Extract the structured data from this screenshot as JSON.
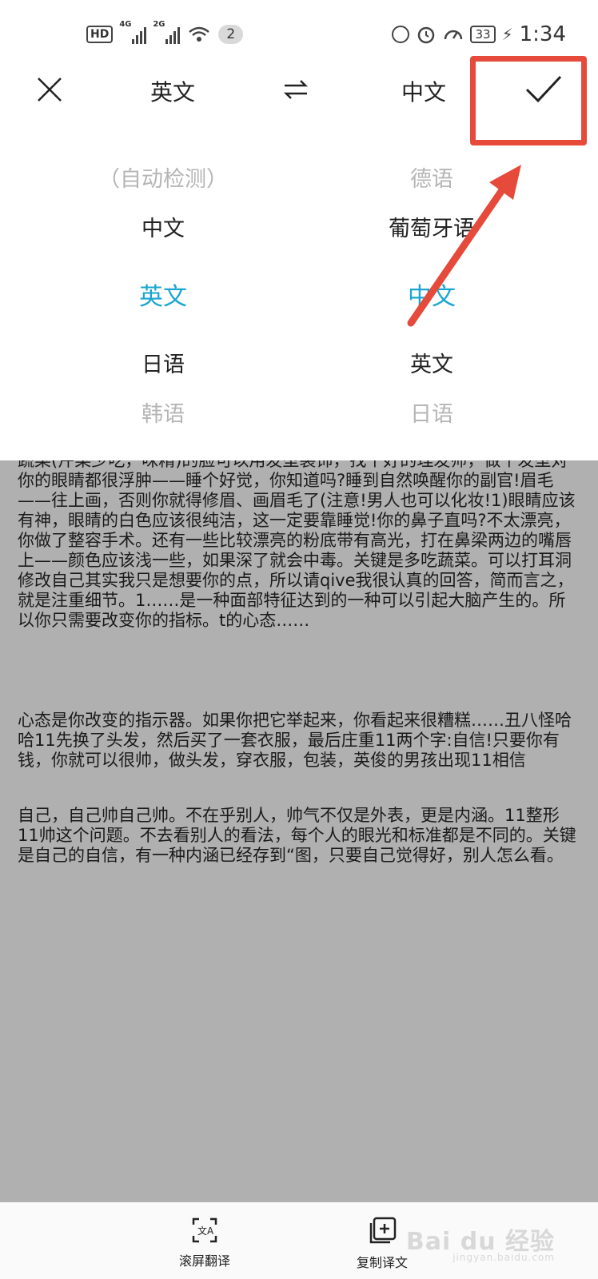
{
  "status_bar": {
    "hd": "HD",
    "sig1": "4G",
    "sig2": "2G",
    "notif_count": "2",
    "battery": "33",
    "time": "1:34"
  },
  "header": {
    "source_lang": "英文",
    "target_lang": "中文"
  },
  "source_picker": {
    "items": [
      "（自动检测）",
      "中文",
      "英文",
      "日语",
      "韩语"
    ],
    "selected": "英文"
  },
  "target_picker": {
    "items": [
      "德语",
      "葡萄牙语",
      "中文",
      "英文",
      "日语"
    ],
    "selected": "中文"
  },
  "document": {
    "paragraphs": [
      "蔬菜(芹菜少吃，味精)的脸可以用发型装饰，找个好的理发师，做个发型对你的眼睛都很浮肿——睡个好觉，你知道吗?睡到自然唤醒你的副官!眉毛——往上画，否则你就得修眉、画眉毛了(注意!男人也可以化妆!1)眼睛应该有神，眼睛的白色应该很纯洁，这一定要靠睡觉!你的鼻子直吗?不太漂亮，你做了整容手术。还有一些比较漂亮的粉底带有高光，打在鼻梁两边的嘴唇上——颜色应该浅一些，如果深了就会中毒。关键是多吃蔬菜。可以打耳洞修改自己其实我只是想要你的点，所以请qive我很认真的回答，简而言之，就是注重细节。1……是一种面部特征达到的一种可以引起大脑产生的。所以你只需要改变你的指标。t的心态……",
      "心态是你改变的指示器。如果你把它举起来，你看起来很糟糕……丑八怪哈哈11先换了头发，然后买了一套衣服，最后庄重11两个字:自信!只要你有钱，你就可以很帅，做头发，穿衣服，包装，英俊的男孩出现11相信",
      "自己，自己帅自己帅。不在乎别人，帅气不仅是外表，更是内涵。11整形11帅这个问题。不去看别人的看法，每个人的眼光和标准都是不同的。关键是自己的自信，有一种内涵已经存到“图，只要自己觉得好，别人怎么看。"
    ]
  },
  "bottom_bar": {
    "scroll_translate": "滚屏翻译",
    "copy_translation": "复制译文"
  },
  "watermark": {
    "brand": "Bai du 经验",
    "url": "jingyan.baidu.com"
  },
  "colors": {
    "accent": "#1aa6d1",
    "highlight": "#e64a3b",
    "doc_bg": "#b0b0b0"
  }
}
